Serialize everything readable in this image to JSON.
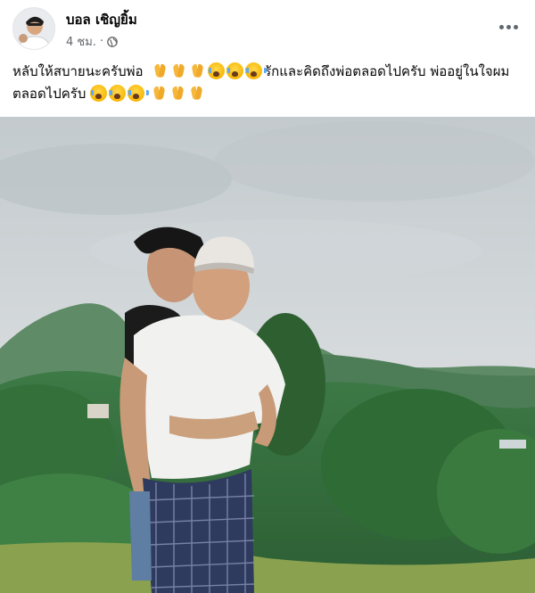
{
  "post": {
    "author_name": "บอล เชิญยิ้ม",
    "timestamp": "4 ชม.",
    "separator": "·",
    "privacy_icon": "globe-icon",
    "more_icon": "more-options-icon",
    "caption_part1": "หลับให้สบายนะครับพ่อ",
    "caption_part2": "รักและคิดถึงพ่อตลอดไปครับ พ่ออยู่ในใจผมตลอดไปครับ",
    "emoji_group1": [
      "folded-hands",
      "folded-hands",
      "folded-hands",
      "crying-face",
      "crying-face",
      "crying-face"
    ],
    "emoji_group2": [
      "crying-face",
      "crying-face",
      "crying-face",
      "folded-hands",
      "folded-hands",
      "folded-hands"
    ]
  },
  "colors": {
    "name_text": "#050505",
    "meta_text": "#65676b",
    "sky": "#cdd3d6",
    "mountain": "#3f7a45"
  }
}
